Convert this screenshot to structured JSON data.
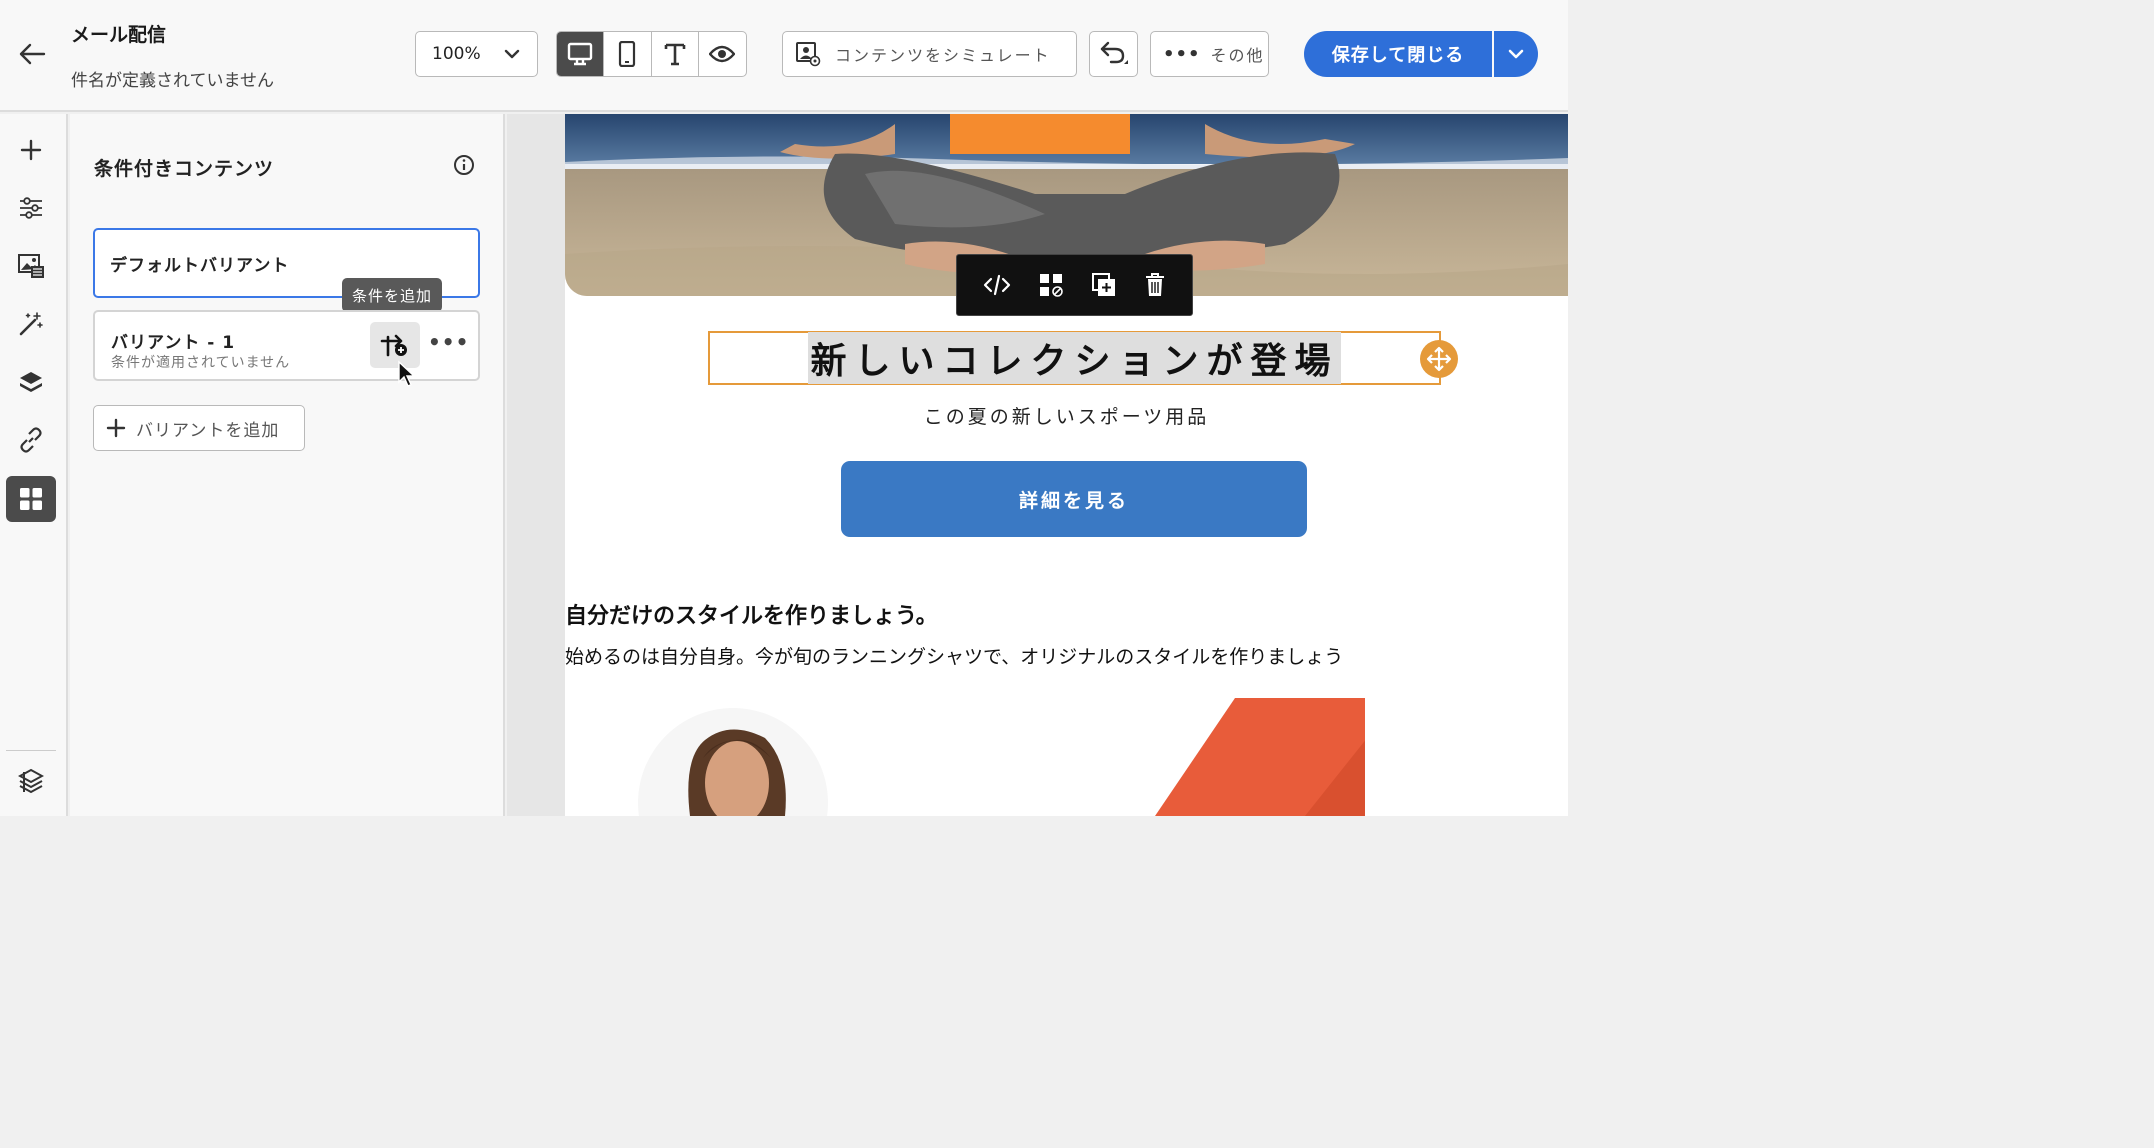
{
  "header": {
    "title": "メール配信",
    "subtitle": "件名が定義されていません",
    "zoom": "100%",
    "simulate_label": "コンテンツをシミュレート",
    "more_label": "その他",
    "save_label": "保存して閉じる",
    "view_modes": [
      "desktop-icon",
      "mobile-icon",
      "text-icon",
      "preview-icon"
    ],
    "active_view": "desktop"
  },
  "rail": {
    "items": [
      "plus-icon",
      "sliders-icon",
      "media-icon",
      "magic-wand-icon",
      "layers-icon",
      "link-icon",
      "fragments-icon"
    ],
    "active": "fragments-icon",
    "bottom": "layer-settings-icon"
  },
  "panel": {
    "title": "条件付きコンテンツ",
    "variants": [
      {
        "label": "デフォルトバリアント",
        "selected": true
      },
      {
        "label": "バリアント - 1",
        "sublabel": "条件が適用されていません"
      }
    ],
    "tooltip": "条件を追加",
    "add_variant_label": "バリアントを追加"
  },
  "email": {
    "headline": "新しいコレクションが登場",
    "subheadline": "この夏の新しいスポーツ用品",
    "cta_label": "詳細を見る",
    "section_title": "自分だけのスタイルを作りましょう。",
    "section_body": "始めるのは自分自身。今が旬のランニングシャツで、オリジナルのスタイルを作りましょう",
    "toolbar_icons": [
      "code-icon",
      "unfragment-icon",
      "duplicate-icon",
      "delete-icon"
    ]
  },
  "colors": {
    "accent": "#2e6fd9",
    "cta": "#3a79c4",
    "selection": "#e59a3a"
  }
}
